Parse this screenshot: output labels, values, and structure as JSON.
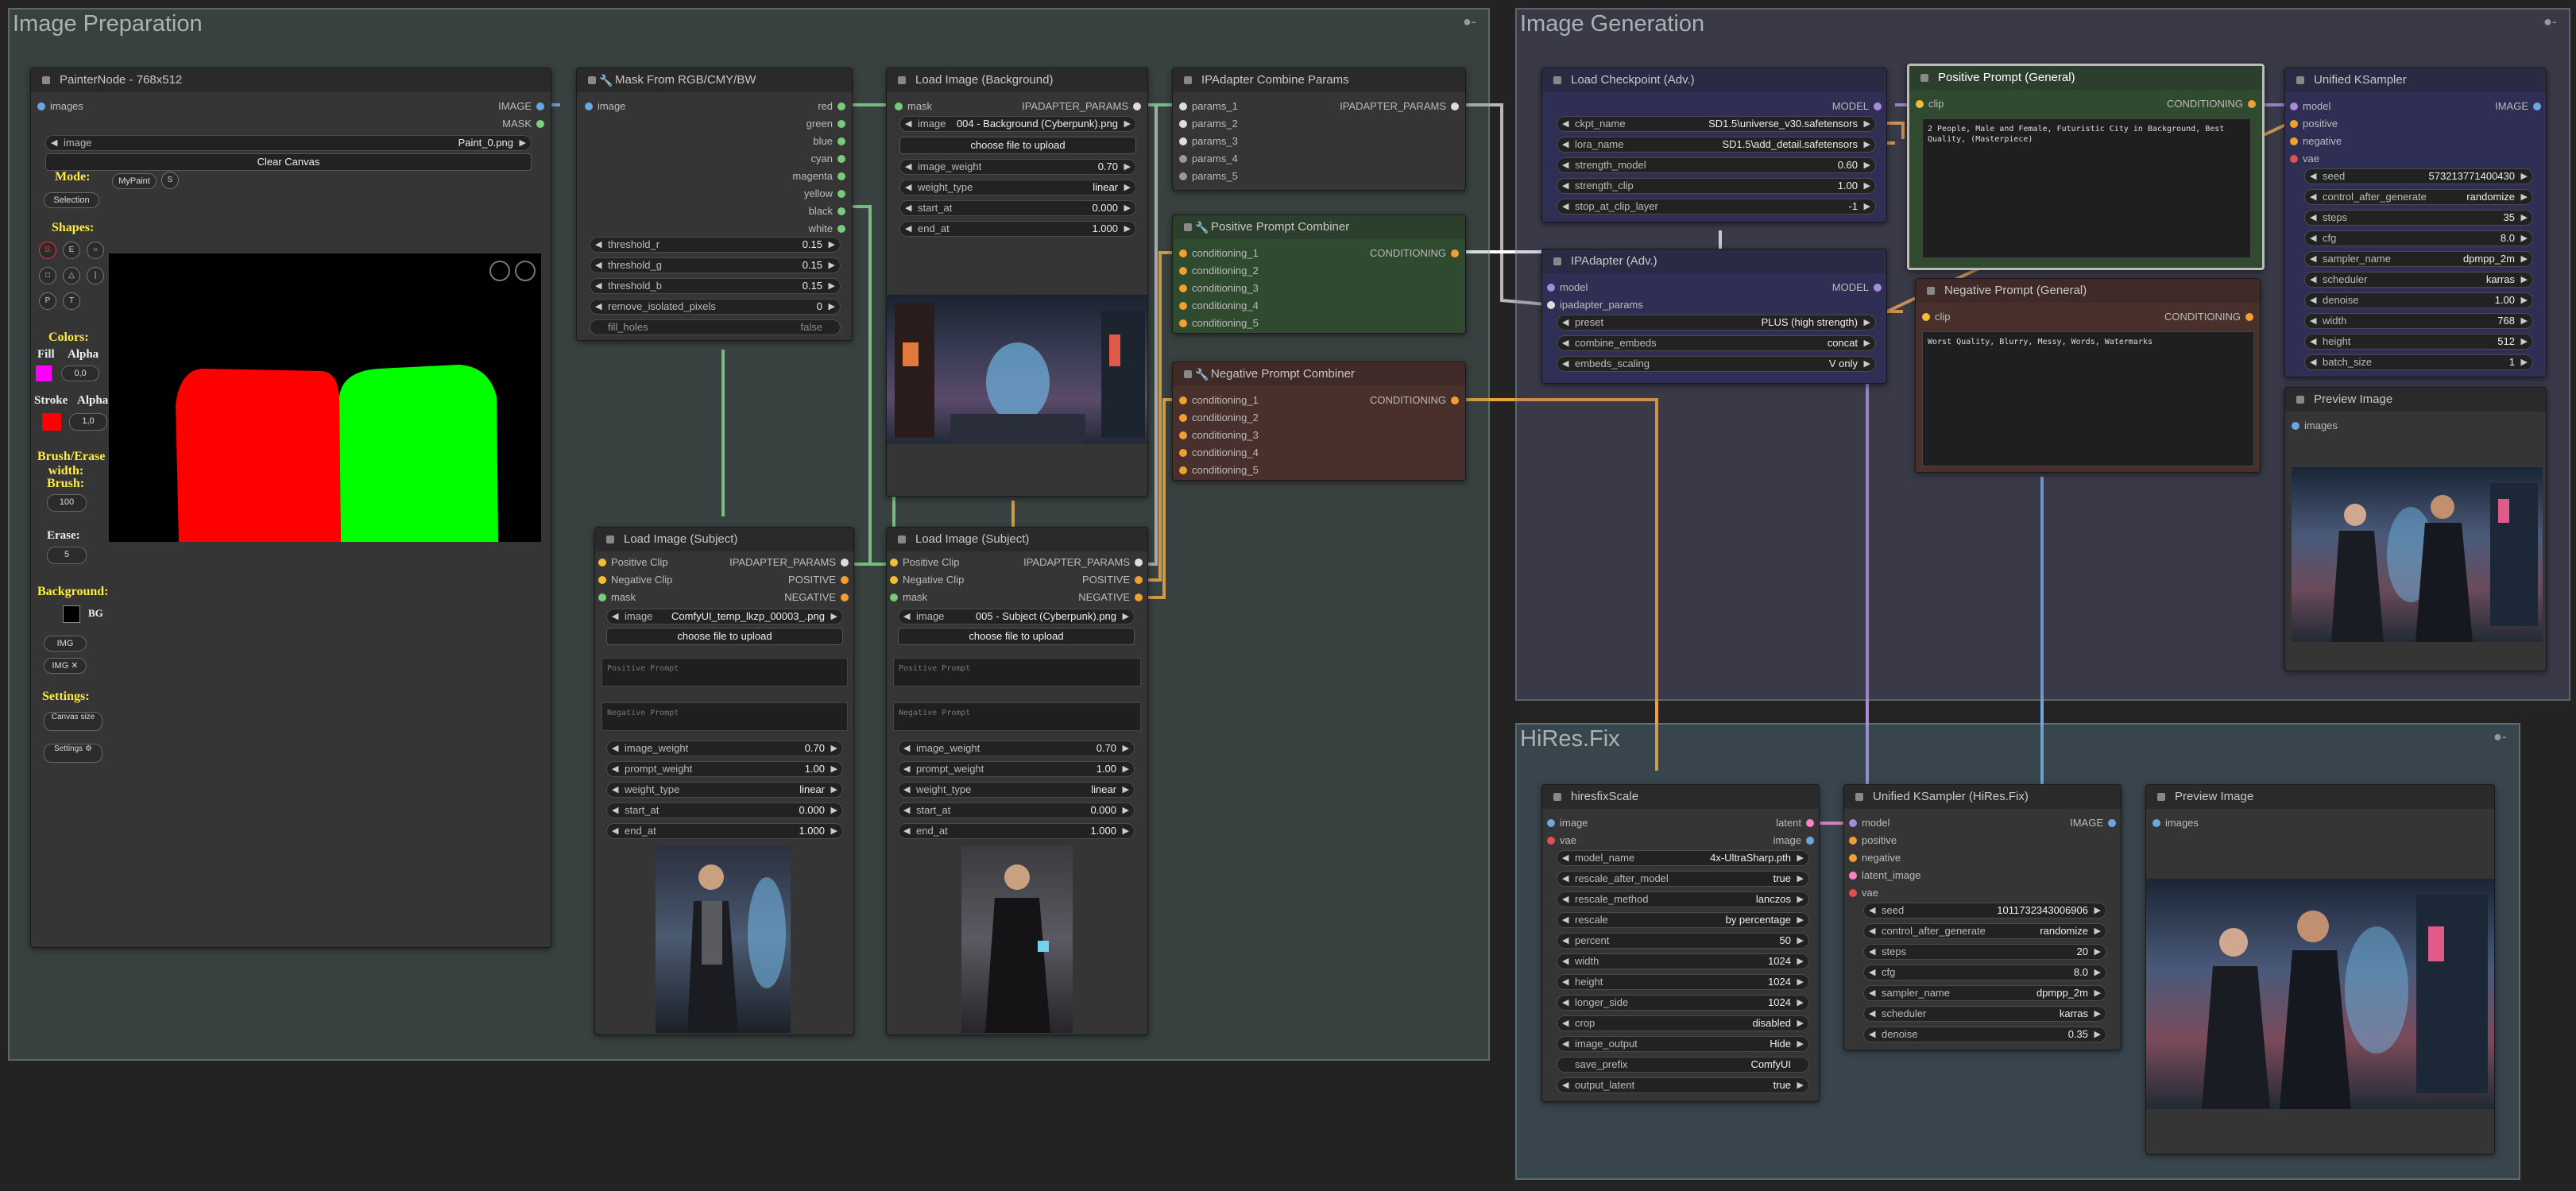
{
  "groups": {
    "prep": "Image Preparation",
    "gen": "Image Generation",
    "hires": "HiRes.Fix"
  },
  "painter": {
    "title": "PainterNode - 768x512",
    "in_images": "images",
    "out_image": "IMAGE",
    "out_mask": "MASK",
    "image_label": "image",
    "image_value": "Paint_0.png",
    "clear_canvas": "Clear Canvas",
    "mode_label": "Mode:",
    "mode_mypaint": "MyPaint",
    "mode_selection": "Selection",
    "shapes_label": "Shapes:",
    "colors_label": "Colors:",
    "fill_label": "Fill",
    "alpha_label": "Alpha",
    "fill_alpha": "0,0",
    "stroke_label": "Stroke",
    "alpha2_label": "Alpha",
    "stroke_alpha": "1,0",
    "brush_label": "Brush/Erase width:",
    "brush_sub": "Brush:",
    "brush_value": "100",
    "erase_label": "Erase:",
    "erase_value": "5",
    "background_label": "Background:",
    "bg_label": "BG",
    "img_btn": "IMG",
    "img_x_btn": "IMG ✕",
    "settings_label": "Settings:",
    "canvas_size_btn": "Canvas size",
    "settings_btn": "Settings ⚙",
    "fill_color": "#ff00ff",
    "stroke_color": "#ff0000",
    "bg_color": "#000000"
  },
  "mask": {
    "title": "Mask From RGB/CMY/BW",
    "in_image": "image",
    "outs": [
      "red",
      "green",
      "blue",
      "cyan",
      "magenta",
      "yellow",
      "black",
      "white"
    ],
    "widgets": [
      [
        "threshold_r",
        "0.15"
      ],
      [
        "threshold_g",
        "0.15"
      ],
      [
        "threshold_b",
        "0.15"
      ],
      [
        "remove_isolated_pixels",
        "0"
      ],
      [
        "fill_holes",
        "false"
      ]
    ]
  },
  "loadbg": {
    "title": "Load Image (Background)",
    "in_mask": "mask",
    "out": "IPADAPTER_PARAMS",
    "image_label": "image",
    "image_value": "004 - Background (Cyberpunk).png",
    "upload": "choose file to upload",
    "widgets": [
      [
        "image_weight",
        "0.70"
      ],
      [
        "weight_type",
        "linear"
      ],
      [
        "start_at",
        "0.000"
      ],
      [
        "end_at",
        "1.000"
      ]
    ]
  },
  "combine": {
    "title": "IPAdapter Combine Params",
    "ins": [
      "params_1",
      "params_2",
      "params_3",
      "params_4",
      "params_5"
    ],
    "out": "IPADAPTER_PARAMS"
  },
  "pospc": {
    "title": "Positive Prompt Combiner",
    "ins": [
      "conditioning_1",
      "conditioning_2",
      "conditioning_3",
      "conditioning_4",
      "conditioning_5"
    ],
    "out": "CONDITIONING"
  },
  "negpc": {
    "title": "Negative Prompt Combiner",
    "ins": [
      "conditioning_1",
      "conditioning_2",
      "conditioning_3",
      "conditioning_4",
      "conditioning_5"
    ],
    "out": "CONDITIONING"
  },
  "subj1": {
    "title": "Load Image (Subject)",
    "ins": [
      "Positive Clip",
      "Negative Clip",
      "mask"
    ],
    "outs": [
      "IPADAPTER_PARAMS",
      "POSITIVE",
      "NEGATIVE"
    ],
    "image_label": "image",
    "image_value": "ComfyUI_temp_lkzp_00003_.png",
    "upload": "choose file to upload",
    "pos_ph": "Positive Prompt",
    "neg_ph": "Negative Prompt",
    "widgets": [
      [
        "image_weight",
        "0.70"
      ],
      [
        "prompt_weight",
        "1.00"
      ],
      [
        "weight_type",
        "linear"
      ],
      [
        "start_at",
        "0.000"
      ],
      [
        "end_at",
        "1.000"
      ]
    ]
  },
  "subj2": {
    "title": "Load Image (Subject)",
    "ins": [
      "Positive Clip",
      "Negative Clip",
      "mask"
    ],
    "outs": [
      "IPADAPTER_PARAMS",
      "POSITIVE",
      "NEGATIVE"
    ],
    "image_label": "image",
    "image_value": "005 - Subject (Cyberpunk).png",
    "upload": "choose file to upload",
    "pos_ph": "Positive Prompt",
    "neg_ph": "Negative Prompt",
    "widgets": [
      [
        "image_weight",
        "0.70"
      ],
      [
        "prompt_weight",
        "1.00"
      ],
      [
        "weight_type",
        "linear"
      ],
      [
        "start_at",
        "0.000"
      ],
      [
        "end_at",
        "1.000"
      ]
    ]
  },
  "ckpt": {
    "title": "Load Checkpoint (Adv.)",
    "out": "MODEL",
    "widgets": [
      [
        "ckpt_name",
        "SD1.5\\universe_v30.safetensors"
      ],
      [
        "lora_name",
        "SD1.5\\add_detail.safetensors"
      ],
      [
        "strength_model",
        "0.60"
      ],
      [
        "strength_clip",
        "1.00"
      ],
      [
        "stop_at_clip_layer",
        "-1"
      ]
    ]
  },
  "ipadv": {
    "title": "IPAdapter (Adv.)",
    "ins": [
      "model",
      "ipadapter_params"
    ],
    "out": "MODEL",
    "widgets": [
      [
        "preset",
        "PLUS (high strength)"
      ],
      [
        "combine_embeds",
        "concat"
      ],
      [
        "embeds_scaling",
        "V only"
      ]
    ]
  },
  "posp": {
    "title": "Positive Prompt (General)",
    "in": "clip",
    "out": "CONDITIONING",
    "text": "2 People, Male and Female, Futuristic City in Background, Best Quality, (Masterpiece)"
  },
  "negp": {
    "title": "Negative Prompt (General)",
    "in": "clip",
    "out": "CONDITIONING",
    "text": "Worst Quality, Blurry, Messy, Words, Watermarks"
  },
  "ks": {
    "title": "Unified KSampler",
    "ins": [
      "model",
      "positive",
      "negative",
      "vae"
    ],
    "out": "IMAGE",
    "widgets": [
      [
        "seed",
        "573213771400430"
      ],
      [
        "control_after_generate",
        "randomize"
      ],
      [
        "steps",
        "35"
      ],
      [
        "cfg",
        "8.0"
      ],
      [
        "sampler_name",
        "dpmpp_2m"
      ],
      [
        "scheduler",
        "karras"
      ],
      [
        "denoise",
        "1.00"
      ],
      [
        "width",
        "768"
      ],
      [
        "height",
        "512"
      ],
      [
        "batch_size",
        "1"
      ]
    ]
  },
  "prev1": {
    "title": "Preview Image",
    "in": "images"
  },
  "hfs": {
    "title": "hiresfixScale",
    "ins": [
      "image",
      "vae"
    ],
    "outs": [
      "latent",
      "image"
    ],
    "widgets": [
      [
        "model_name",
        "4x-UltraSharp.pth"
      ],
      [
        "rescale_after_model",
        "true"
      ],
      [
        "rescale_method",
        "lanczos"
      ],
      [
        "rescale",
        "by percentage"
      ],
      [
        "percent",
        "50"
      ],
      [
        "width",
        "1024"
      ],
      [
        "height",
        "1024"
      ],
      [
        "longer_side",
        "1024"
      ],
      [
        "crop",
        "disabled"
      ],
      [
        "image_output",
        "Hide"
      ],
      [
        "save_prefix",
        "ComfyUI"
      ],
      [
        "output_latent",
        "true"
      ]
    ]
  },
  "ks2": {
    "title": "Unified KSampler (HiRes.Fix)",
    "ins": [
      "model",
      "positive",
      "negative",
      "latent_image",
      "vae"
    ],
    "out": "IMAGE",
    "widgets": [
      [
        "seed",
        "1011732343006906"
      ],
      [
        "control_after_generate",
        "randomize"
      ],
      [
        "steps",
        "20"
      ],
      [
        "cfg",
        "8.0"
      ],
      [
        "sampler_name",
        "dpmpp_2m"
      ],
      [
        "scheduler",
        "karras"
      ],
      [
        "denoise",
        "0.35"
      ]
    ]
  },
  "prev2": {
    "title": "Preview Image",
    "in": "images"
  }
}
